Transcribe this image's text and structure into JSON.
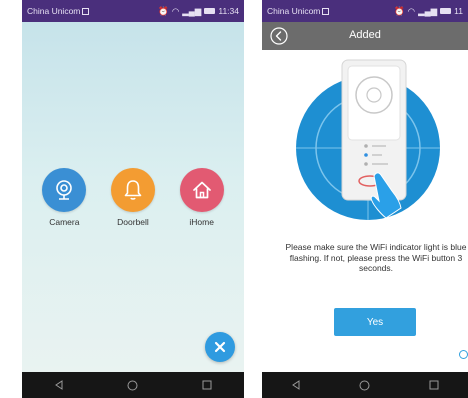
{
  "colors": {
    "status_bar": "#4a2f7c",
    "nav_bar": "#161616",
    "accent_blue": "#32a0de",
    "camera_app": "#3a8fd4",
    "doorbell_app": "#f39c32",
    "ihome_app": "#e25a72",
    "header_gray": "#6c6c6c"
  },
  "left_screen": {
    "status_bar": {
      "carrier": "China Unicom",
      "time": "11:34"
    },
    "apps": [
      {
        "label": "Camera",
        "icon": "camera-icon",
        "color": "#3a8fd4"
      },
      {
        "label": "Doorbell",
        "icon": "bell-icon",
        "color": "#f39c32"
      },
      {
        "label": "iHome",
        "icon": "home-icon",
        "color": "#e25a72"
      }
    ],
    "fab_icon": "close-icon",
    "nav_icons": [
      "back-icon",
      "home-circle-icon",
      "recents-icon"
    ]
  },
  "right_screen": {
    "status_bar": {
      "carrier": "China Unicom",
      "time": "11"
    },
    "header": {
      "title": "Added",
      "back_icon": "back-arrow-icon"
    },
    "instruction": {
      "line1": "Please make sure the WiFi indicator light is blue",
      "line2": "flashing. If not, please press the WiFi button 3",
      "line3": "seconds."
    },
    "yes_button": "Yes",
    "nav_icons": [
      "back-icon",
      "home-circle-icon",
      "recents-icon"
    ]
  }
}
